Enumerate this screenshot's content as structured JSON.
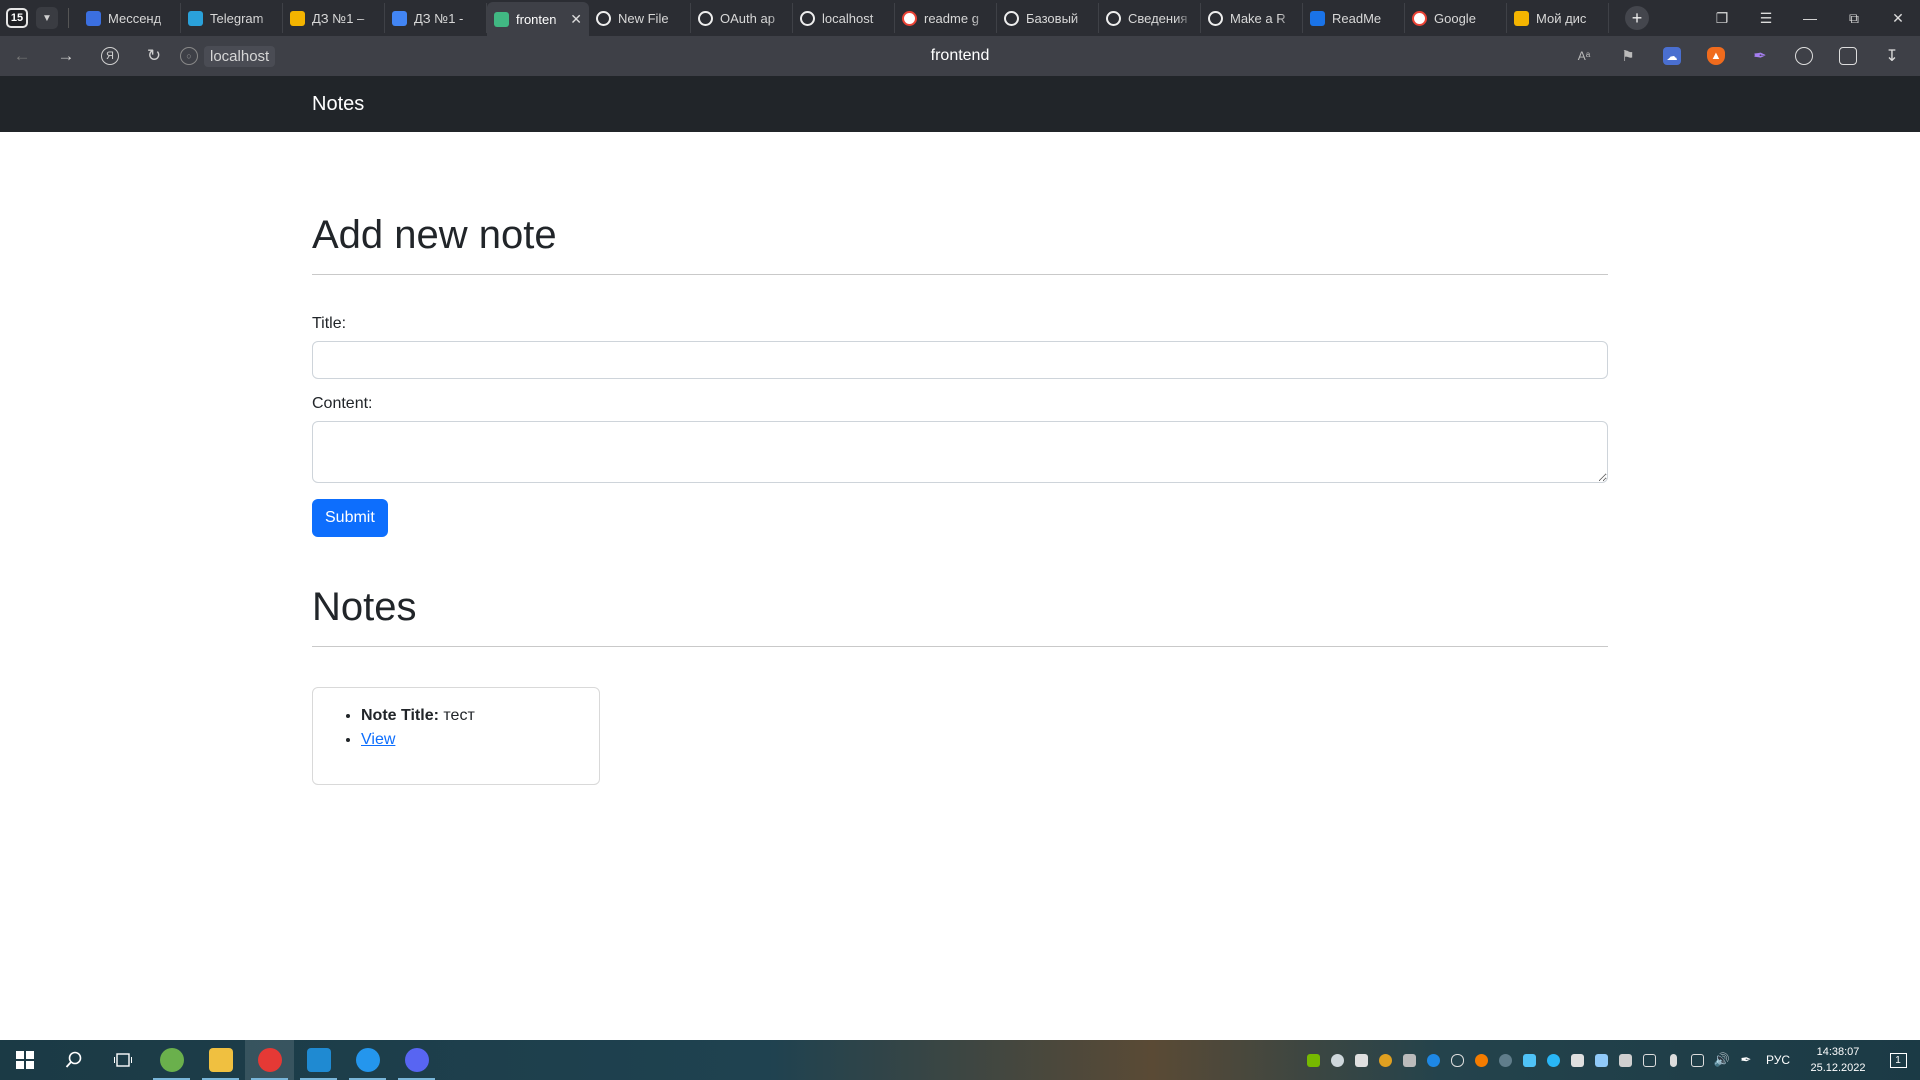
{
  "browser": {
    "tab_count": "15",
    "tabs": [
      {
        "label": "Мессенд",
        "icon": "messenger-icon",
        "color": "#3b6fe0"
      },
      {
        "label": "Telegram",
        "icon": "telegram-icon",
        "color": "#2aa1da"
      },
      {
        "label": "ДЗ №1 –",
        "icon": "google-drive-icon",
        "color": "#f4b400"
      },
      {
        "label": "ДЗ №1 -",
        "icon": "google-docs-icon",
        "color": "#4285f4"
      },
      {
        "label": "fronten",
        "icon": "vue-icon",
        "color": "#41b883",
        "active": true
      },
      {
        "label": "New File",
        "icon": "github-icon",
        "color": "#2b2d33"
      },
      {
        "label": "OAuth ap",
        "icon": "github-icon",
        "color": "#2b2d33"
      },
      {
        "label": "localhost",
        "icon": "page-icon",
        "color": "#2b2d33"
      },
      {
        "label": "readme g",
        "icon": "google-icon",
        "color": "#ffffff"
      },
      {
        "label": "Базовый",
        "icon": "github-icon",
        "color": "#2b2d33"
      },
      {
        "label": "Сведения",
        "icon": "github-icon",
        "color": "#2b2d33"
      },
      {
        "label": "Make a R",
        "icon": "page-icon",
        "color": "#2b2d33"
      },
      {
        "label": "ReadMe",
        "icon": "readme-icon",
        "color": "#1a73e8"
      },
      {
        "label": "Google",
        "icon": "google-icon",
        "color": "#ffffff"
      },
      {
        "label": "Мой дис",
        "icon": "google-drive-icon",
        "color": "#f4b400"
      }
    ],
    "address": {
      "host": "localhost",
      "page_title": "frontend"
    }
  },
  "app": {
    "brand": "Notes",
    "add_section": {
      "heading": "Add new note",
      "title_label": "Title:",
      "title_value": "",
      "content_label": "Content:",
      "content_value": "",
      "submit_label": "Submit"
    },
    "notes_section": {
      "heading": "Notes",
      "notes": [
        {
          "title_label": "Note Title:",
          "title": "тест",
          "view_label": "View"
        }
      ]
    }
  },
  "taskbar": {
    "lang": "РУС",
    "time": "14:38:07",
    "date": "25.12.2022",
    "notification_count": "1",
    "apps": [
      {
        "name": "utorrent-icon",
        "color": "#6ab04c"
      },
      {
        "name": "file-explorer-icon",
        "color": "#f0c040"
      },
      {
        "name": "yandex-browser-icon",
        "color": "#e53935"
      },
      {
        "name": "vscode-icon",
        "color": "#1f8ad2"
      },
      {
        "name": "docker-icon",
        "color": "#2496ed"
      },
      {
        "name": "discord-icon",
        "color": "#5865f2"
      }
    ]
  }
}
